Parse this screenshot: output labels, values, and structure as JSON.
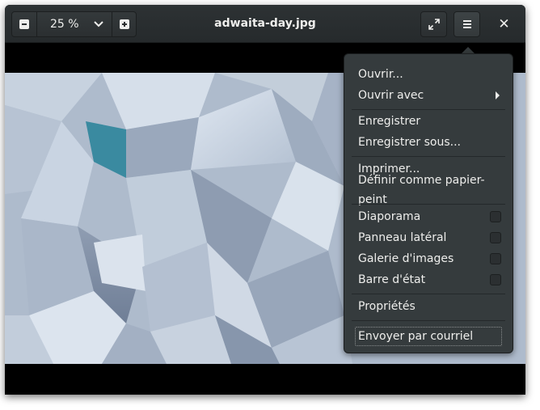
{
  "window": {
    "title": "adwaita-day.jpg"
  },
  "toolbar": {
    "zoom_value": "25 %",
    "zoom_out_icon": "minus-box-icon",
    "zoom_in_icon": "plus-box-icon",
    "zoom_dropdown_icon": "chevron-down-icon",
    "fullscreen_icon": "fullscreen-icon",
    "menu_icon": "hamburger-icon",
    "close_icon": "close-icon"
  },
  "menu": {
    "open": "Ouvrir...",
    "open_with": "Ouvrir avec",
    "save": "Enregistrer",
    "save_as": "Enregistrer sous...",
    "print": "Imprimer...",
    "set_wallpaper": "Définir comme papier-peint",
    "slideshow": "Diaporama",
    "side_panel": "Panneau latéral",
    "image_gallery": "Galerie d'images",
    "status_bar": "Barre d'état",
    "properties": "Propriétés",
    "send_email": "Envoyer par courriel"
  },
  "menu_checks": {
    "slideshow": false,
    "side_panel": false,
    "image_gallery": false,
    "status_bar": false
  },
  "colors": {
    "headerbar": "#2d3234",
    "popover": "#353b3d",
    "text": "#eeeeec"
  }
}
